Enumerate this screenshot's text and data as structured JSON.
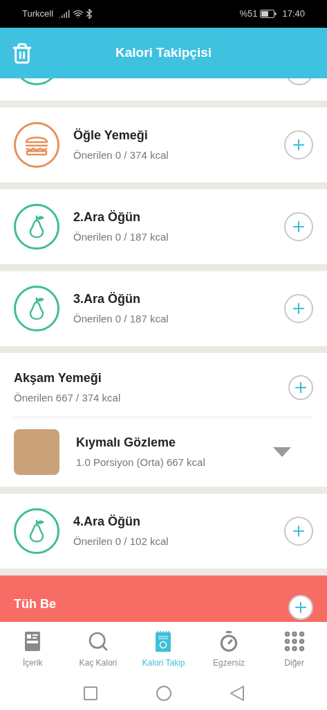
{
  "status_bar": {
    "carrier": "Turkcell",
    "battery": "%51",
    "time": "17:40"
  },
  "header": {
    "title": "Kalori Takipçisi"
  },
  "meals": [
    {
      "kind": "burger",
      "title": "Öğle Yemeği",
      "subtitle": "Önerilen 0 / 374 kcal"
    },
    {
      "kind": "pear",
      "title": "2.Ara Öğün",
      "subtitle": "Önerilen 0 / 187 kcal"
    },
    {
      "kind": "pear",
      "title": "3.Ara Öğün",
      "subtitle": "Önerilen 0 / 187 kcal"
    },
    {
      "kind": "logged",
      "title": "Akşam Yemeği",
      "subtitle": "Önerilen 667 / 374 kcal",
      "foods": [
        {
          "name": "Kıymalı Gözleme",
          "portion": "1.0 Porsiyon (Orta) 667 kcal"
        }
      ]
    },
    {
      "kind": "pear",
      "title": "4.Ara Öğün",
      "subtitle": "Önerilen 0 / 102 kcal"
    }
  ],
  "alert": {
    "title": "Tüh Be"
  },
  "tabs": [
    {
      "kind": "article",
      "label": "İçerik",
      "selected": false
    },
    {
      "kind": "search",
      "label": "Kaç Kalori",
      "selected": false
    },
    {
      "kind": "notepad",
      "label": "Kalori Takip",
      "selected": true
    },
    {
      "kind": "stopwatch",
      "label": "Egzersiz",
      "selected": false
    },
    {
      "kind": "dots",
      "label": "Diğer",
      "selected": false
    }
  ]
}
